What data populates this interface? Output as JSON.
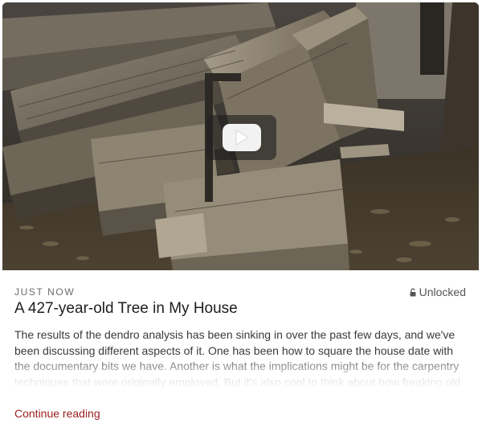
{
  "post": {
    "video": {
      "play_icon": "play-icon"
    },
    "timestamp": "JUST NOW",
    "access": {
      "icon": "unlock-icon",
      "label": "Unlocked"
    },
    "title": "A 427-year-old Tree in My House",
    "excerpt": "The results of the dendro analysis has been sinking in over the past few days, and we've been discussing different aspects of it. One has been how to square the house date with the documentary bits we have. Another is what the implications might be for the carpentry techniques that were originally employed. But it's also cool to think about how freaking old",
    "continue_label": "Continue reading"
  },
  "colors": {
    "link": "#9b1d1d",
    "title": "#1e1e1e",
    "text": "#3a3a3a",
    "meta": "#6b6b6b"
  }
}
